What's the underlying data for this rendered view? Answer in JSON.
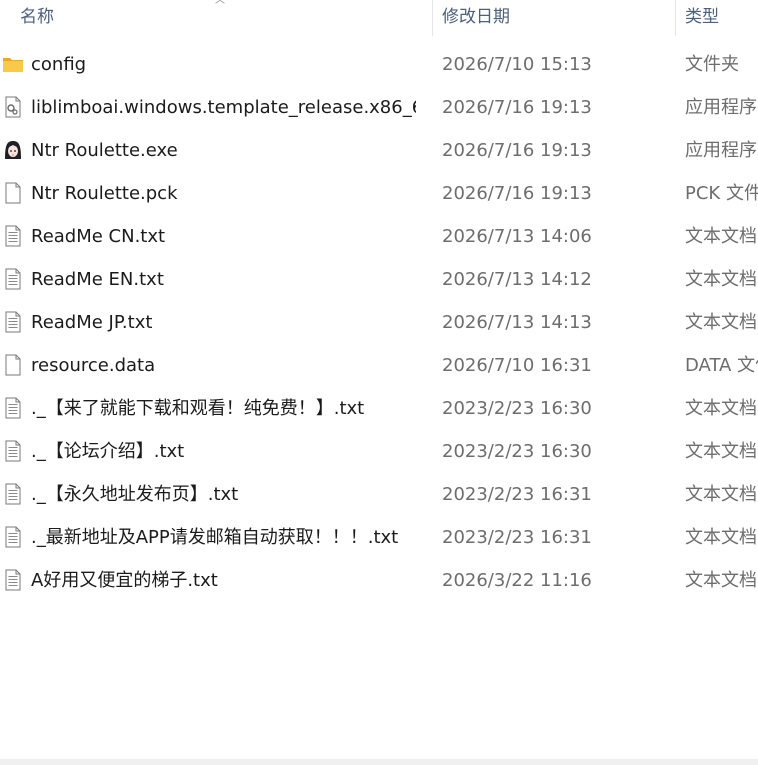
{
  "columns": {
    "name": "名称",
    "date": "修改日期",
    "type": "类型"
  },
  "files": [
    {
      "name": "config",
      "date": "2026/7/10 15:13",
      "type": "文件夹",
      "icon": "folder-icon"
    },
    {
      "name": "liblimboai.windows.template_release.x86_6...",
      "date": "2026/7/16 19:13",
      "type": "应用程序扩展",
      "icon": "dll-icon"
    },
    {
      "name": "Ntr Roulette.exe",
      "date": "2026/7/16 19:13",
      "type": "应用程序",
      "icon": "app-character-icon"
    },
    {
      "name": "Ntr Roulette.pck",
      "date": "2026/7/16 19:13",
      "type": "PCK 文件",
      "icon": "blank-file-icon"
    },
    {
      "name": "ReadMe CN.txt",
      "date": "2026/7/13 14:06",
      "type": "文本文档",
      "icon": "text-file-icon"
    },
    {
      "name": "ReadMe EN.txt",
      "date": "2026/7/13 14:12",
      "type": "文本文档",
      "icon": "text-file-icon"
    },
    {
      "name": "ReadMe JP.txt",
      "date": "2026/7/13 14:13",
      "type": "文本文档",
      "icon": "text-file-icon"
    },
    {
      "name": "resource.data",
      "date": "2026/7/10 16:31",
      "type": "DATA 文件",
      "icon": "blank-file-icon"
    },
    {
      "name": "._【来了就能下载和观看！纯免费！】.txt",
      "date": "2023/2/23 16:30",
      "type": "文本文档",
      "icon": "text-file-icon"
    },
    {
      "name": "._【论坛介绍】.txt",
      "date": "2023/2/23 16:30",
      "type": "文本文档",
      "icon": "text-file-icon"
    },
    {
      "name": "._【永久地址发布页】.txt",
      "date": "2023/2/23 16:31",
      "type": "文本文档",
      "icon": "text-file-icon"
    },
    {
      "name": "._最新地址及APP请发邮箱自动获取！！！.txt",
      "date": "2023/2/23 16:31",
      "type": "文本文档",
      "icon": "text-file-icon"
    },
    {
      "name": "A好用又便宜的梯子.txt",
      "date": "2026/3/22 11:16",
      "type": "文本文档",
      "icon": "text-file-icon"
    }
  ],
  "colors": {
    "header_text": "#4c607a",
    "name_text": "#1b1b1b",
    "meta_text": "#6d6d6d",
    "folder": "#f5c342"
  }
}
